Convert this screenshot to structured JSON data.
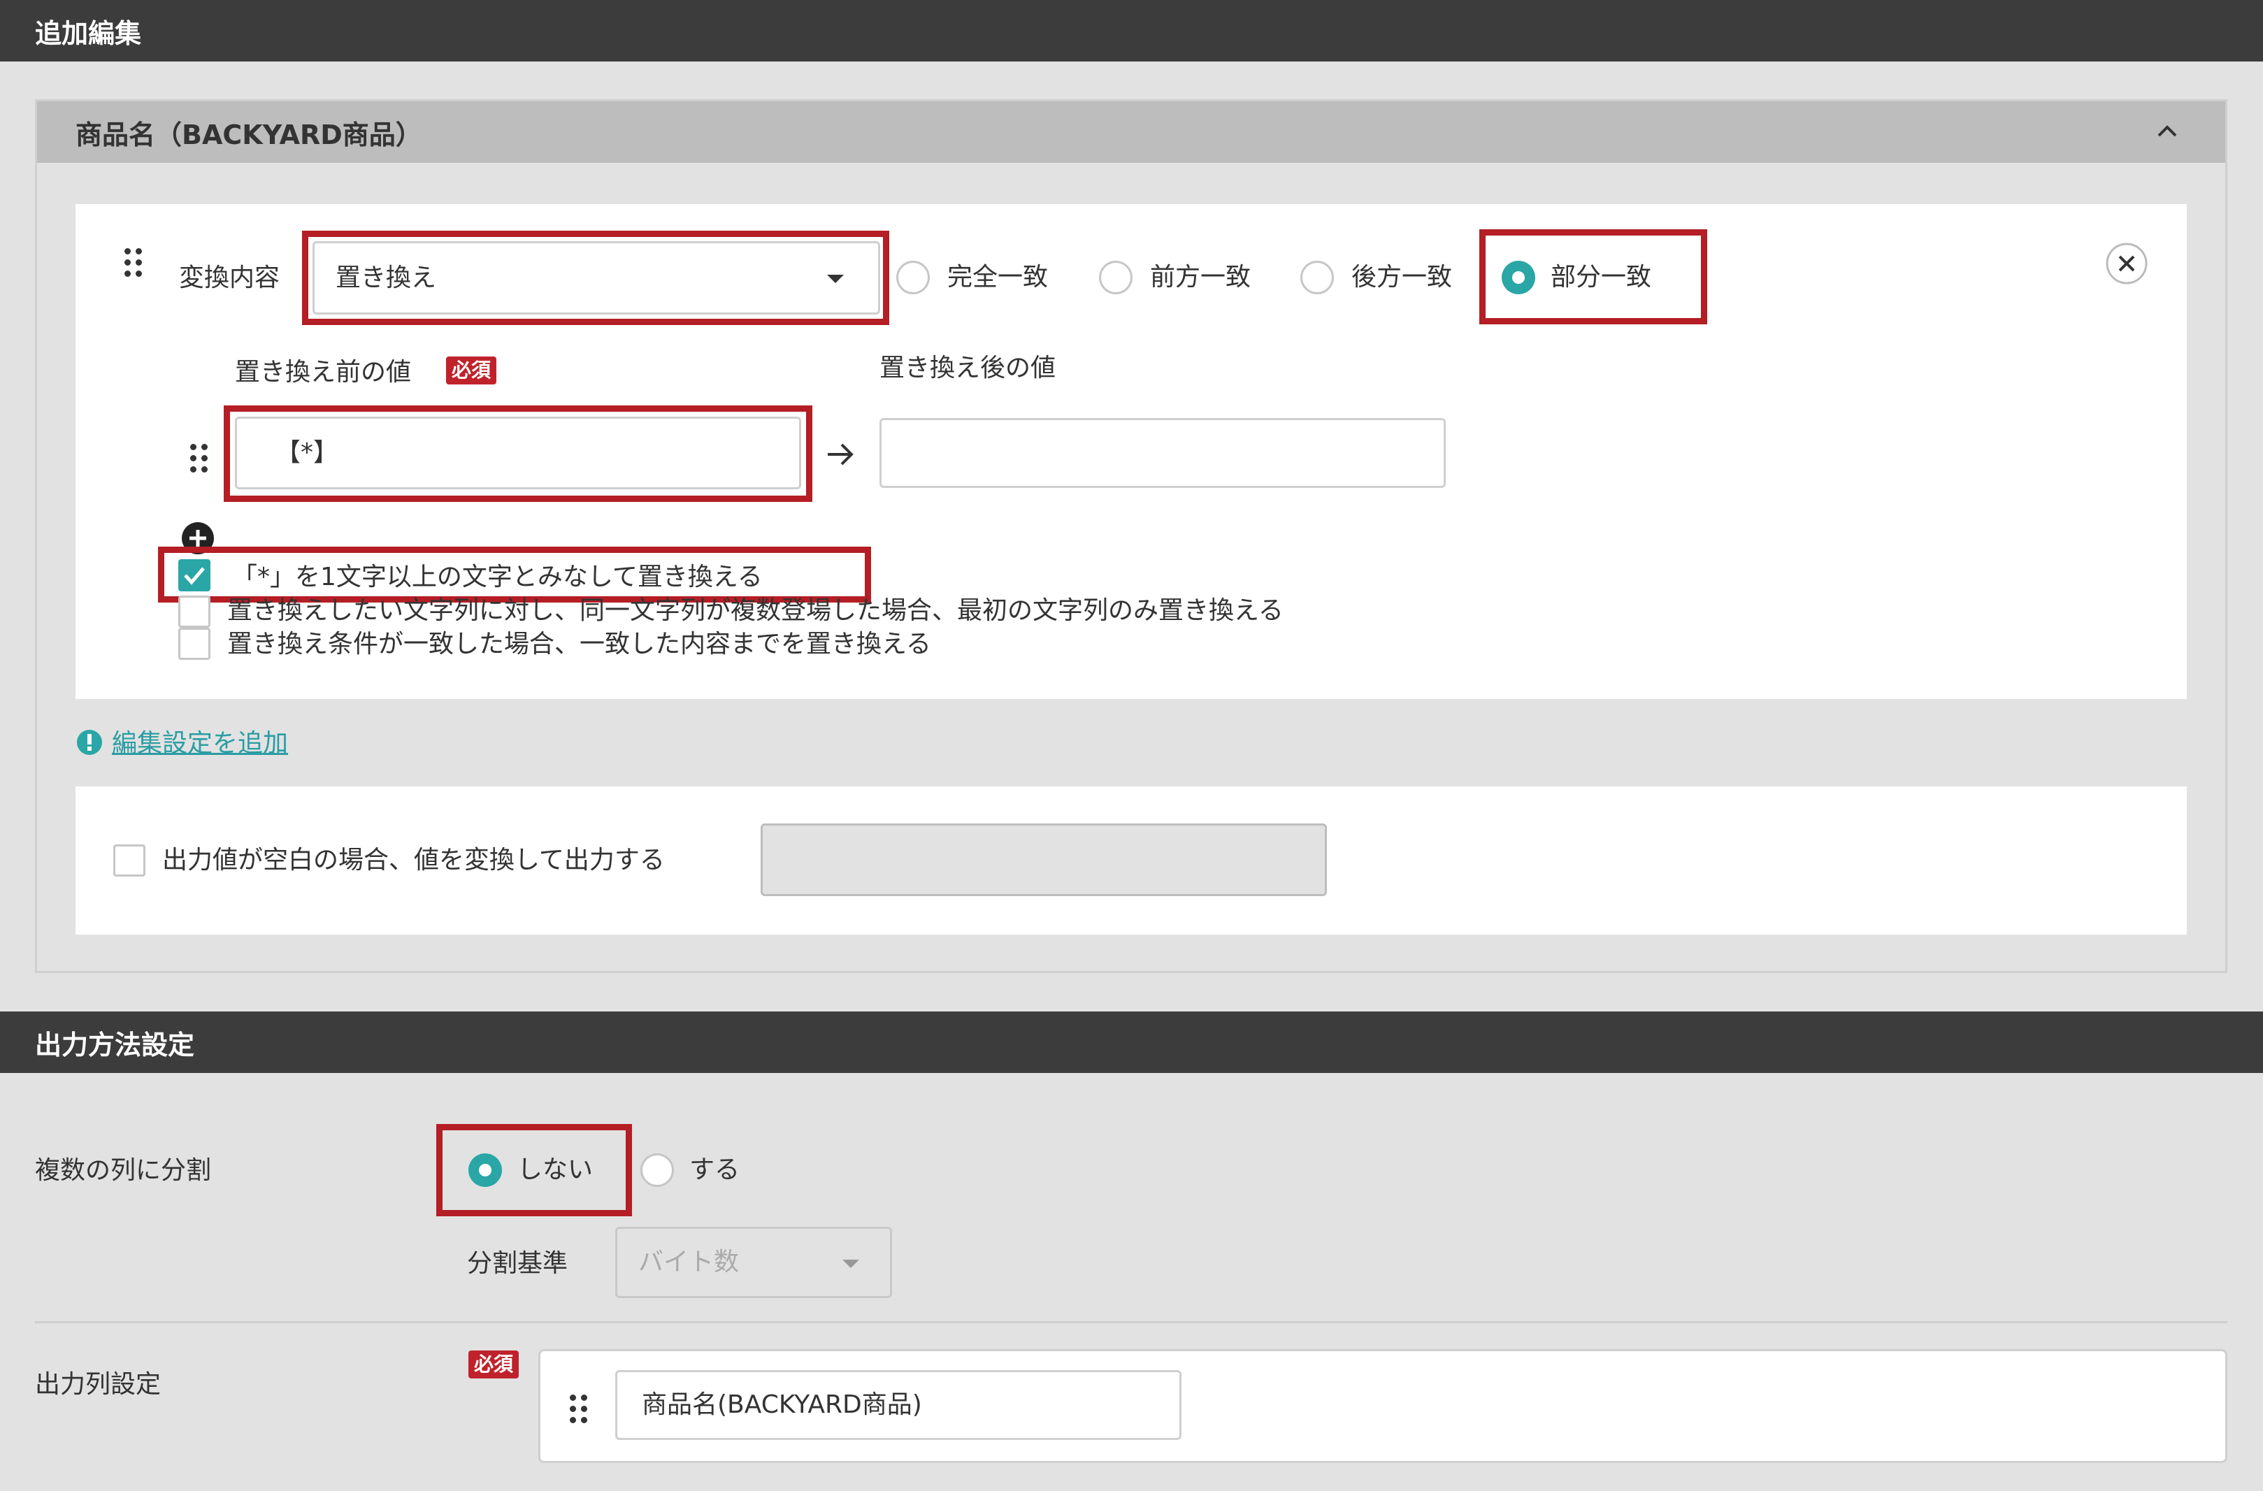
{
  "header_edit": "追加編集",
  "panel": {
    "title": "商品名（BACKYARD商品）"
  },
  "rule": {
    "conversion_label": "変換内容",
    "conversion_value": "置き換え",
    "match_options": [
      "完全一致",
      "前方一致",
      "後方一致",
      "部分一致"
    ],
    "selected_match": "部分一致",
    "before_label": "置き換え前の値",
    "required_badge": "必須",
    "after_label": "置き換え後の値",
    "before_value": "【*】",
    "after_value": "",
    "checkboxes": [
      {
        "label": "「*」を1文字以上の文字とみなして置き換える",
        "checked": true
      },
      {
        "label": "置き換えしたい文字列に対し、同一文字列が複数登場した場合、最初の文字列のみ置き換える",
        "checked": false
      },
      {
        "label": "置き換え条件が一致した場合、一致した内容までを置き換える",
        "checked": false
      }
    ]
  },
  "add_edit_link": "編集設定を追加",
  "blank_output": {
    "label": "出力値が空白の場合、値を変換して出力する",
    "checked": false,
    "value": ""
  },
  "header_output": "出力方法設定",
  "split": {
    "label": "複数の列に分割",
    "options": [
      "しない",
      "する"
    ],
    "selected": "しない",
    "basis_label": "分割基準",
    "basis_value": "バイト数"
  },
  "output_columns": {
    "label": "出力列設定",
    "required_badge": "必須",
    "column_value": "商品名(BACKYARD商品)"
  },
  "colors": {
    "accent": "#2aa6a6",
    "highlight": "#b41e24",
    "header_bg": "#3c3c3c"
  }
}
